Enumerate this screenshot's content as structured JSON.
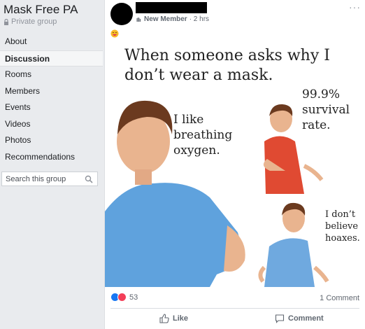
{
  "group": {
    "name": "Mask Free PA",
    "privacy": "Private group"
  },
  "nav": {
    "items": [
      {
        "label": "About"
      },
      {
        "label": "Discussion"
      },
      {
        "label": "Rooms"
      },
      {
        "label": "Members"
      },
      {
        "label": "Events"
      },
      {
        "label": "Videos"
      },
      {
        "label": "Photos"
      },
      {
        "label": "Recommendations"
      }
    ],
    "active": "Discussion"
  },
  "search": {
    "placeholder": "Search this group"
  },
  "post": {
    "author_badge": "New Member",
    "time": "· 2 hrs",
    "more": "···",
    "meme": {
      "headline": "When someone asks why I don’t wear a mask.",
      "label_1": "I like breathing oxygen.",
      "label_2": "99.9% survival rate.",
      "label_3": "I don’t believe hoaxes."
    },
    "reaction_count": "53",
    "comments": "1 Comment",
    "like_label": "Like",
    "comment_label": "Comment"
  },
  "colors": {
    "accent": "#1877f2",
    "love": "#f33e58",
    "sidebar_bg": "#e9ebee"
  }
}
